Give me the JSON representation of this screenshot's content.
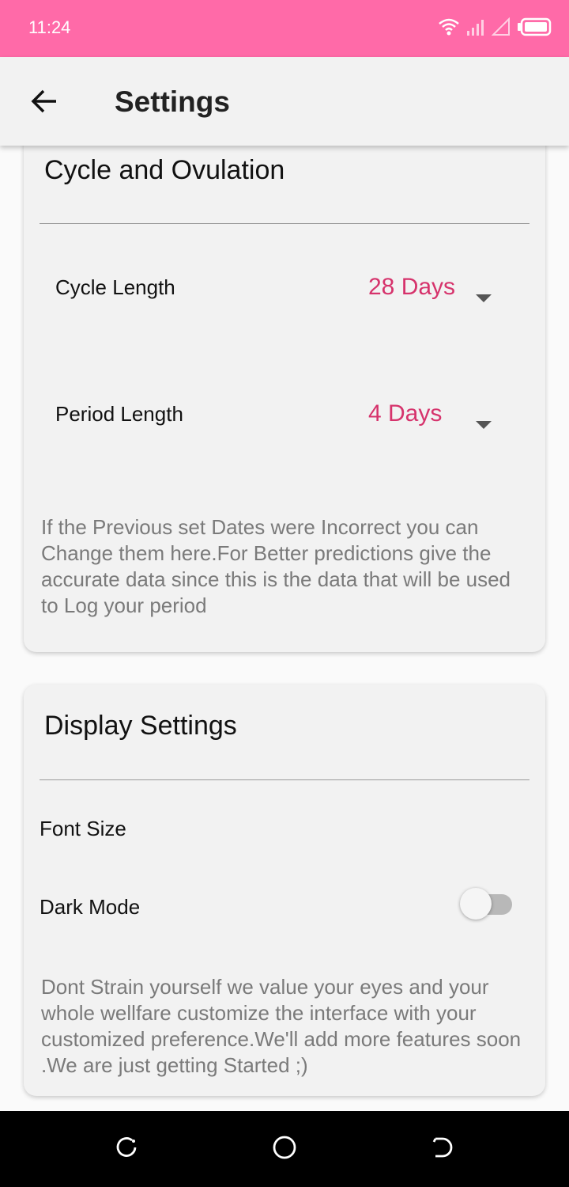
{
  "status_bar": {
    "time": "11:24",
    "icons": [
      "wifi-icon",
      "signal-icon",
      "signal-empty-icon",
      "battery-icon"
    ],
    "color": "#ff6aa8"
  },
  "app_bar": {
    "title": "Settings",
    "back_icon": "arrow-left-icon"
  },
  "cycle_card": {
    "title": "Cycle and Ovulation",
    "cycle_length": {
      "label": "Cycle Length",
      "value": "28 Days"
    },
    "period_length": {
      "label": "Period Length",
      "value": "4 Days"
    },
    "description": "If the Previous set Dates were Incorrect you can Change them here.For Better predictions give the accurate data since this is the data that will be used to Log your period"
  },
  "display_card": {
    "title": "Display Settings",
    "font_size_label": "Font Size",
    "dark_mode_label": "Dark Mode",
    "dark_mode_enabled": false,
    "description": "Dont Strain yourself we value your eyes and your whole wellfare customize the interface with your customized preference.We'll add more features soon .We are just getting Started ;)"
  },
  "nav_bar": {
    "icons": [
      "recents-icon",
      "home-icon",
      "back-icon"
    ]
  },
  "colors": {
    "accent": "#d6336c",
    "status_bar": "#ff6aa8",
    "card_bg": "#f2f2f2"
  }
}
